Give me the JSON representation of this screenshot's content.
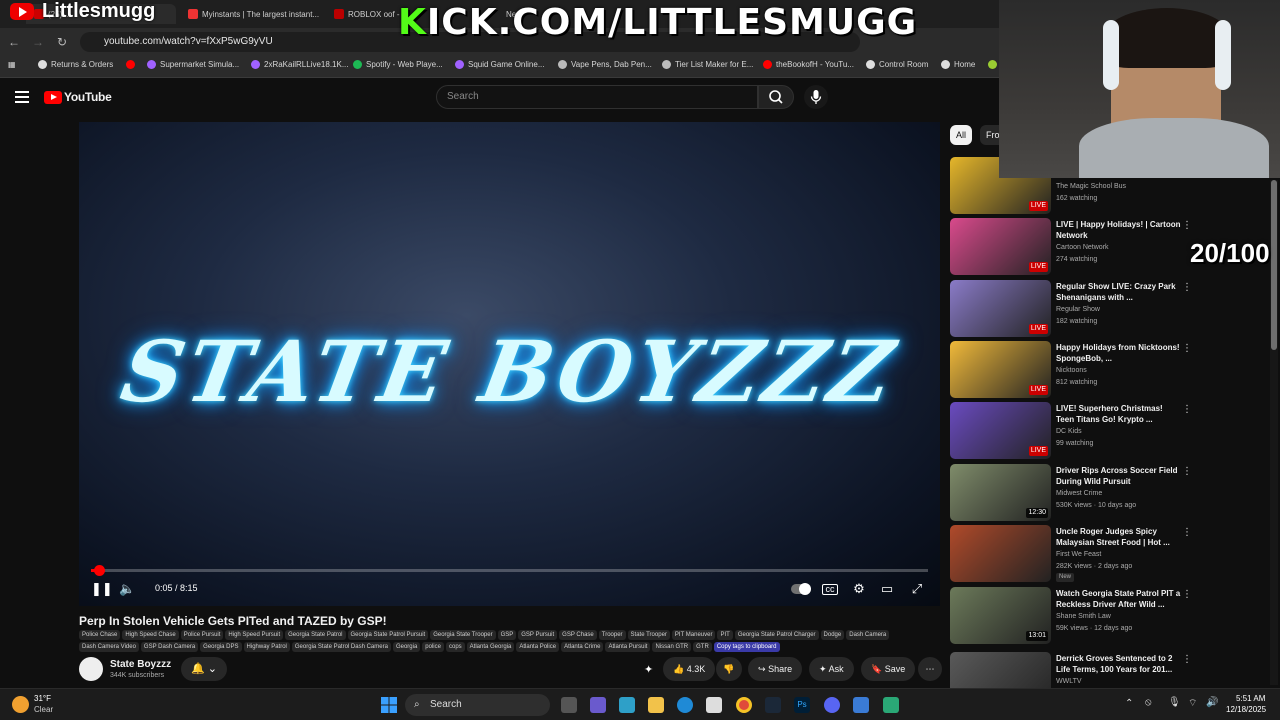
{
  "browser": {
    "tabs": [
      {
        "label": "(26) ...",
        "active": true
      },
      {
        "label": "Myinstants | The largest instant..."
      },
      {
        "label": "ROBLOX oof - ..."
      },
      {
        "label": "New"
      }
    ],
    "url": "youtube.com/watch?v=fXxP5wG9yVU",
    "bookmarks": [
      {
        "label": "Returns & Orders",
        "color": "#ddd"
      },
      {
        "label": "Supermarket Simula...",
        "color": "#a061ff"
      },
      {
        "label": "2xRaKailRLLive18.1K...",
        "color": "#a061ff"
      },
      {
        "label": "Spotify - Web Playe...",
        "color": "#1db954"
      },
      {
        "label": "Squid Game Online...",
        "color": "#a061ff"
      },
      {
        "label": "Vape Pens, Dab Pen...",
        "color": "#bbb"
      },
      {
        "label": "Tier List Maker for E...",
        "color": "#bbb"
      },
      {
        "label": "theBookofH - YouTu...",
        "color": "#ff0000"
      },
      {
        "label": "Control Room",
        "color": "#ddd"
      },
      {
        "label": "Home",
        "color": "#ddd"
      }
    ]
  },
  "overlay": {
    "streamer_name": "Littlesmugg",
    "kick_k": "K",
    "kick_rest": "ICK.COM/LITTLESMUGG",
    "counter": "20/100"
  },
  "youtube": {
    "logo_text": "YouTube",
    "search_placeholder": "Search"
  },
  "player": {
    "screen_text": "STATE BOYZZZ",
    "time": "0:05 / 8:15",
    "progress_fraction": 0.01
  },
  "video": {
    "title": "Perp In Stolen Vehicle Gets PITed and TAZED by GSP!",
    "tags": [
      "Police Chase",
      "High Speed Chase",
      "Police Pursuit",
      "High Speed Pursuit",
      "Georgia State Patrol",
      "Georgia State Patrol Pursuit",
      "Georgia State Trooper",
      "GSP",
      "GSP Pursuit",
      "GSP Chase",
      "Trooper",
      "State Trooper",
      "PIT Maneuver",
      "PIT",
      "Georgia State Patrol Charger",
      "Dodge",
      "Dash Camera",
      "Dash Camera Video",
      "GSP Dash Camera",
      "Georgia DPS",
      "Highway Patrol",
      "Georgia State Patrol Dash Camera",
      "Georgia",
      "police",
      "cops",
      "Atlanta Georgia",
      "Atlanta Police",
      "Atlanta Crime",
      "Atlanta Pursuit",
      "Nissan GTR",
      "GTR"
    ],
    "copy_tags": "Copy tags to clipboard",
    "channel_name": "State Boyzzz",
    "subscribers": "344K subscribers",
    "likes": "4.3K",
    "share": "Share",
    "ask": "Ask",
    "save": "Save"
  },
  "sidebar": {
    "chips": [
      "All",
      "Fro"
    ],
    "items": [
      {
        "title": "",
        "channel": "The Magic School Bus",
        "meta": "162 watching",
        "badge": "LIVE",
        "thumb": "#e5b62a"
      },
      {
        "title": "LIVE | Happy Holidays! | Cartoon Network",
        "channel": "Cartoon Network",
        "meta": "274 watching",
        "badge": "LIVE",
        "thumb": "#d94a8c"
      },
      {
        "title": "Regular Show LIVE: Crazy Park Shenanigans with ...",
        "channel": "Regular Show",
        "meta": "182 watching",
        "badge": "LIVE",
        "thumb": "#8a7bc8"
      },
      {
        "title": "Happy Holidays from Nicktoons! SpongeBob, ...",
        "channel": "Nicktoons",
        "meta": "812 watching",
        "badge": "LIVE",
        "thumb": "#f0b93a"
      },
      {
        "title": "LIVE! Superhero Christmas! Teen Titans Go! Krypto ...",
        "channel": "DC Kids",
        "meta": "99 watching",
        "badge": "LIVE",
        "thumb": "#6a4bc0"
      },
      {
        "title": "Driver Rips Across Soccer Field During Wild Pursuit",
        "channel": "Midwest Crime",
        "meta": "530K views · 10 days ago",
        "badge": "12:30",
        "thumb": "#7f8c6a"
      },
      {
        "title": "Uncle Roger Judges Spicy Malaysian Street Food | Hot ...",
        "channel": "First We Feast",
        "meta": "282K views · 2 days ago",
        "badge": "",
        "new": "New",
        "thumb": "#b04a2a"
      },
      {
        "title": "Watch Georgia State Patrol PIT a Reckless Driver After Wild ...",
        "channel": "Shane Smith Law",
        "meta": "59K views · 12 days ago",
        "badge": "13:01",
        "thumb": "#6c7a5a"
      },
      {
        "title": "Derrick Groves Sentenced to 2 Life Terms, 100 Years for 201...",
        "channel": "WWLTV",
        "meta": "",
        "badge": "",
        "thumb": "#5a5a5a"
      }
    ]
  },
  "taskbar": {
    "temp": "31°F",
    "weather": "Clear",
    "search": "Search",
    "time": "5:51 AM",
    "date": "12/18/2025"
  }
}
